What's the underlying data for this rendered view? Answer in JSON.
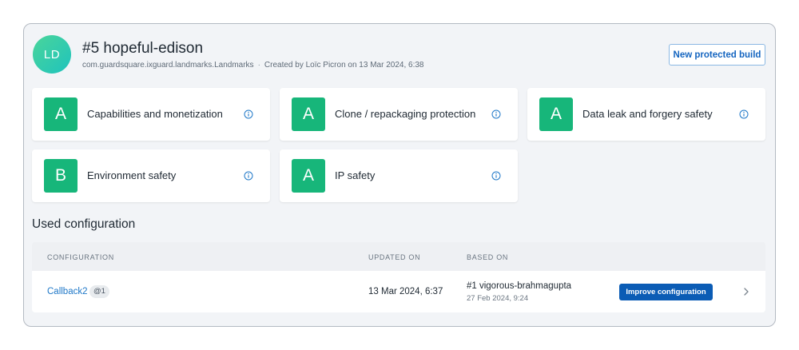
{
  "build": {
    "avatar_initials": "LD",
    "title": "#5 hopeful-edison",
    "package": "com.guardsquare.ixguard.landmarks.Landmarks",
    "separator": "·",
    "created": "Created by Loïc Picron on 13 Mar 2024, 6:38",
    "new_build_label": "New protected build"
  },
  "scores": [
    {
      "grade": "A",
      "label": "Capabilities and monetization"
    },
    {
      "grade": "A",
      "label": "Clone / repackaging protection"
    },
    {
      "grade": "A",
      "label": "Data leak and forgery safety"
    },
    {
      "grade": "B",
      "label": "Environment safety"
    },
    {
      "grade": "A",
      "label": "IP safety"
    }
  ],
  "configuration": {
    "section_title": "Used configuration",
    "headers": {
      "configuration": "CONFIGURATION",
      "updated_on": "UPDATED ON",
      "based_on": "BASED ON"
    },
    "row": {
      "name": "Callback2",
      "tag": "@1",
      "updated": "13 Mar 2024, 6:37",
      "based_name": "#1 vigorous-brahmagupta",
      "based_date": "27 Feb 2024, 9:24",
      "improve_label": "Improve configuration"
    }
  },
  "colors": {
    "grade_green": "#17b67a",
    "link_blue": "#1f78c8",
    "primary_button": "#0b5cb5",
    "avatar_gradient_start": "#4ad59a",
    "avatar_gradient_end": "#1fc3bd"
  },
  "icons": {
    "score_info": "info-circle-icon",
    "row_chevron": "chevron-right-icon"
  }
}
